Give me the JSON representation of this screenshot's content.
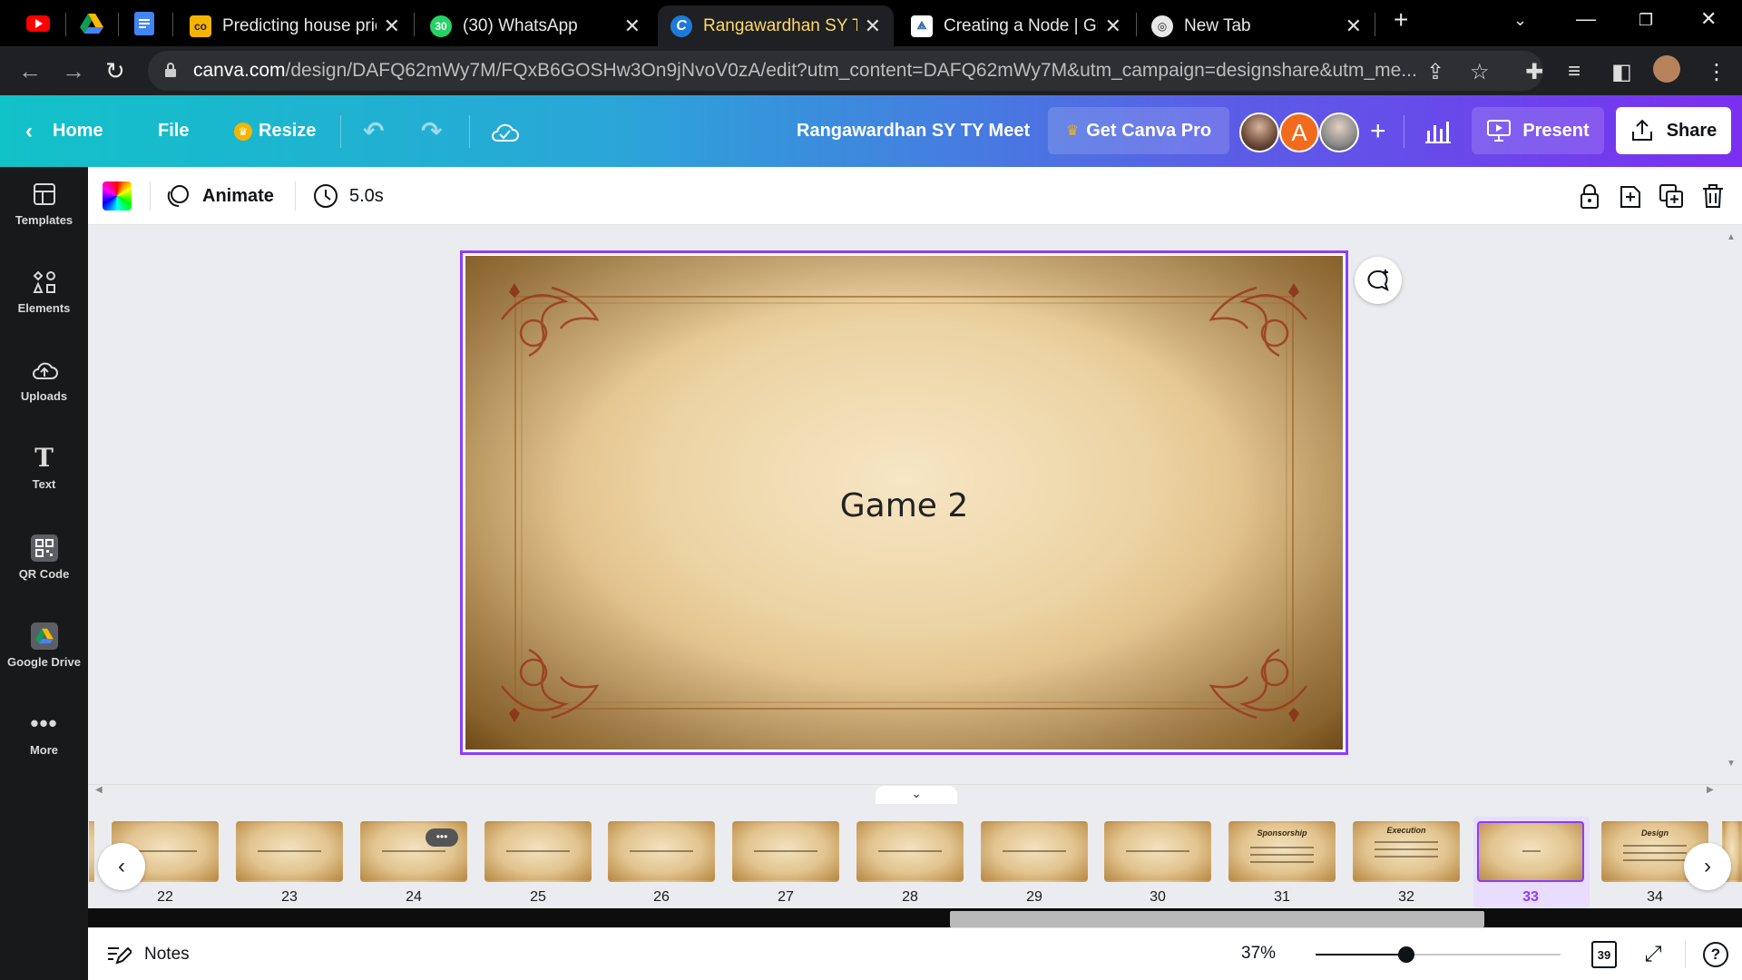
{
  "browser": {
    "tabs": [
      {
        "title": "Predicting house pric",
        "active": false
      },
      {
        "title": "(30) WhatsApp",
        "active": false
      },
      {
        "title": "Rangawardhan SY TY",
        "active": true
      },
      {
        "title": "Creating a Node | Gra",
        "active": false
      },
      {
        "title": "New Tab",
        "active": false
      }
    ],
    "whatsapp_badge": "30",
    "url_host": "canva.com",
    "url_path": "/design/DAFQ62mWy7M/FQxB6GOSHw3On9jNvoV0zA/edit?utm_content=DAFQ62mWy7M&utm_campaign=designshare&utm_me..."
  },
  "header": {
    "home": "Home",
    "file": "File",
    "resize": "Resize",
    "title": "Rangawardhan SY TY Meet",
    "get_pro": "Get Canva Pro",
    "avatar_letter": "A",
    "present": "Present",
    "share": "Share"
  },
  "sidebar": {
    "items": [
      {
        "label": "Templates",
        "icon": "templates-icon"
      },
      {
        "label": "Elements",
        "icon": "elements-icon"
      },
      {
        "label": "Uploads",
        "icon": "uploads-icon"
      },
      {
        "label": "Text",
        "icon": "text-icon"
      },
      {
        "label": "QR Code",
        "icon": "qr-code-icon"
      },
      {
        "label": "Google Drive",
        "icon": "google-drive-icon"
      },
      {
        "label": "More",
        "icon": "more-icon"
      }
    ]
  },
  "toolbar": {
    "animate": "Animate",
    "duration": "5.0s"
  },
  "slide": {
    "title": "Game 2"
  },
  "pages": {
    "thumbs": [
      {
        "num": "22",
        "heading": ""
      },
      {
        "num": "23",
        "heading": ""
      },
      {
        "num": "24",
        "heading": ""
      },
      {
        "num": "25",
        "heading": ""
      },
      {
        "num": "26",
        "heading": ""
      },
      {
        "num": "27",
        "heading": ""
      },
      {
        "num": "28",
        "heading": ""
      },
      {
        "num": "29",
        "heading": ""
      },
      {
        "num": "30",
        "heading": ""
      },
      {
        "num": "31",
        "heading": "Sponsorship"
      },
      {
        "num": "32",
        "heading": "Execution"
      },
      {
        "num": "33",
        "heading": ""
      },
      {
        "num": "34",
        "heading": "Design"
      }
    ],
    "selected": "33",
    "total": "39"
  },
  "bottom": {
    "notes": "Notes",
    "zoom": "37%",
    "zoom_fraction": 0.37
  },
  "colors": {
    "accent": "#8b3dff",
    "header_start": "#11c2c8",
    "header_end": "#7b2ff0"
  }
}
